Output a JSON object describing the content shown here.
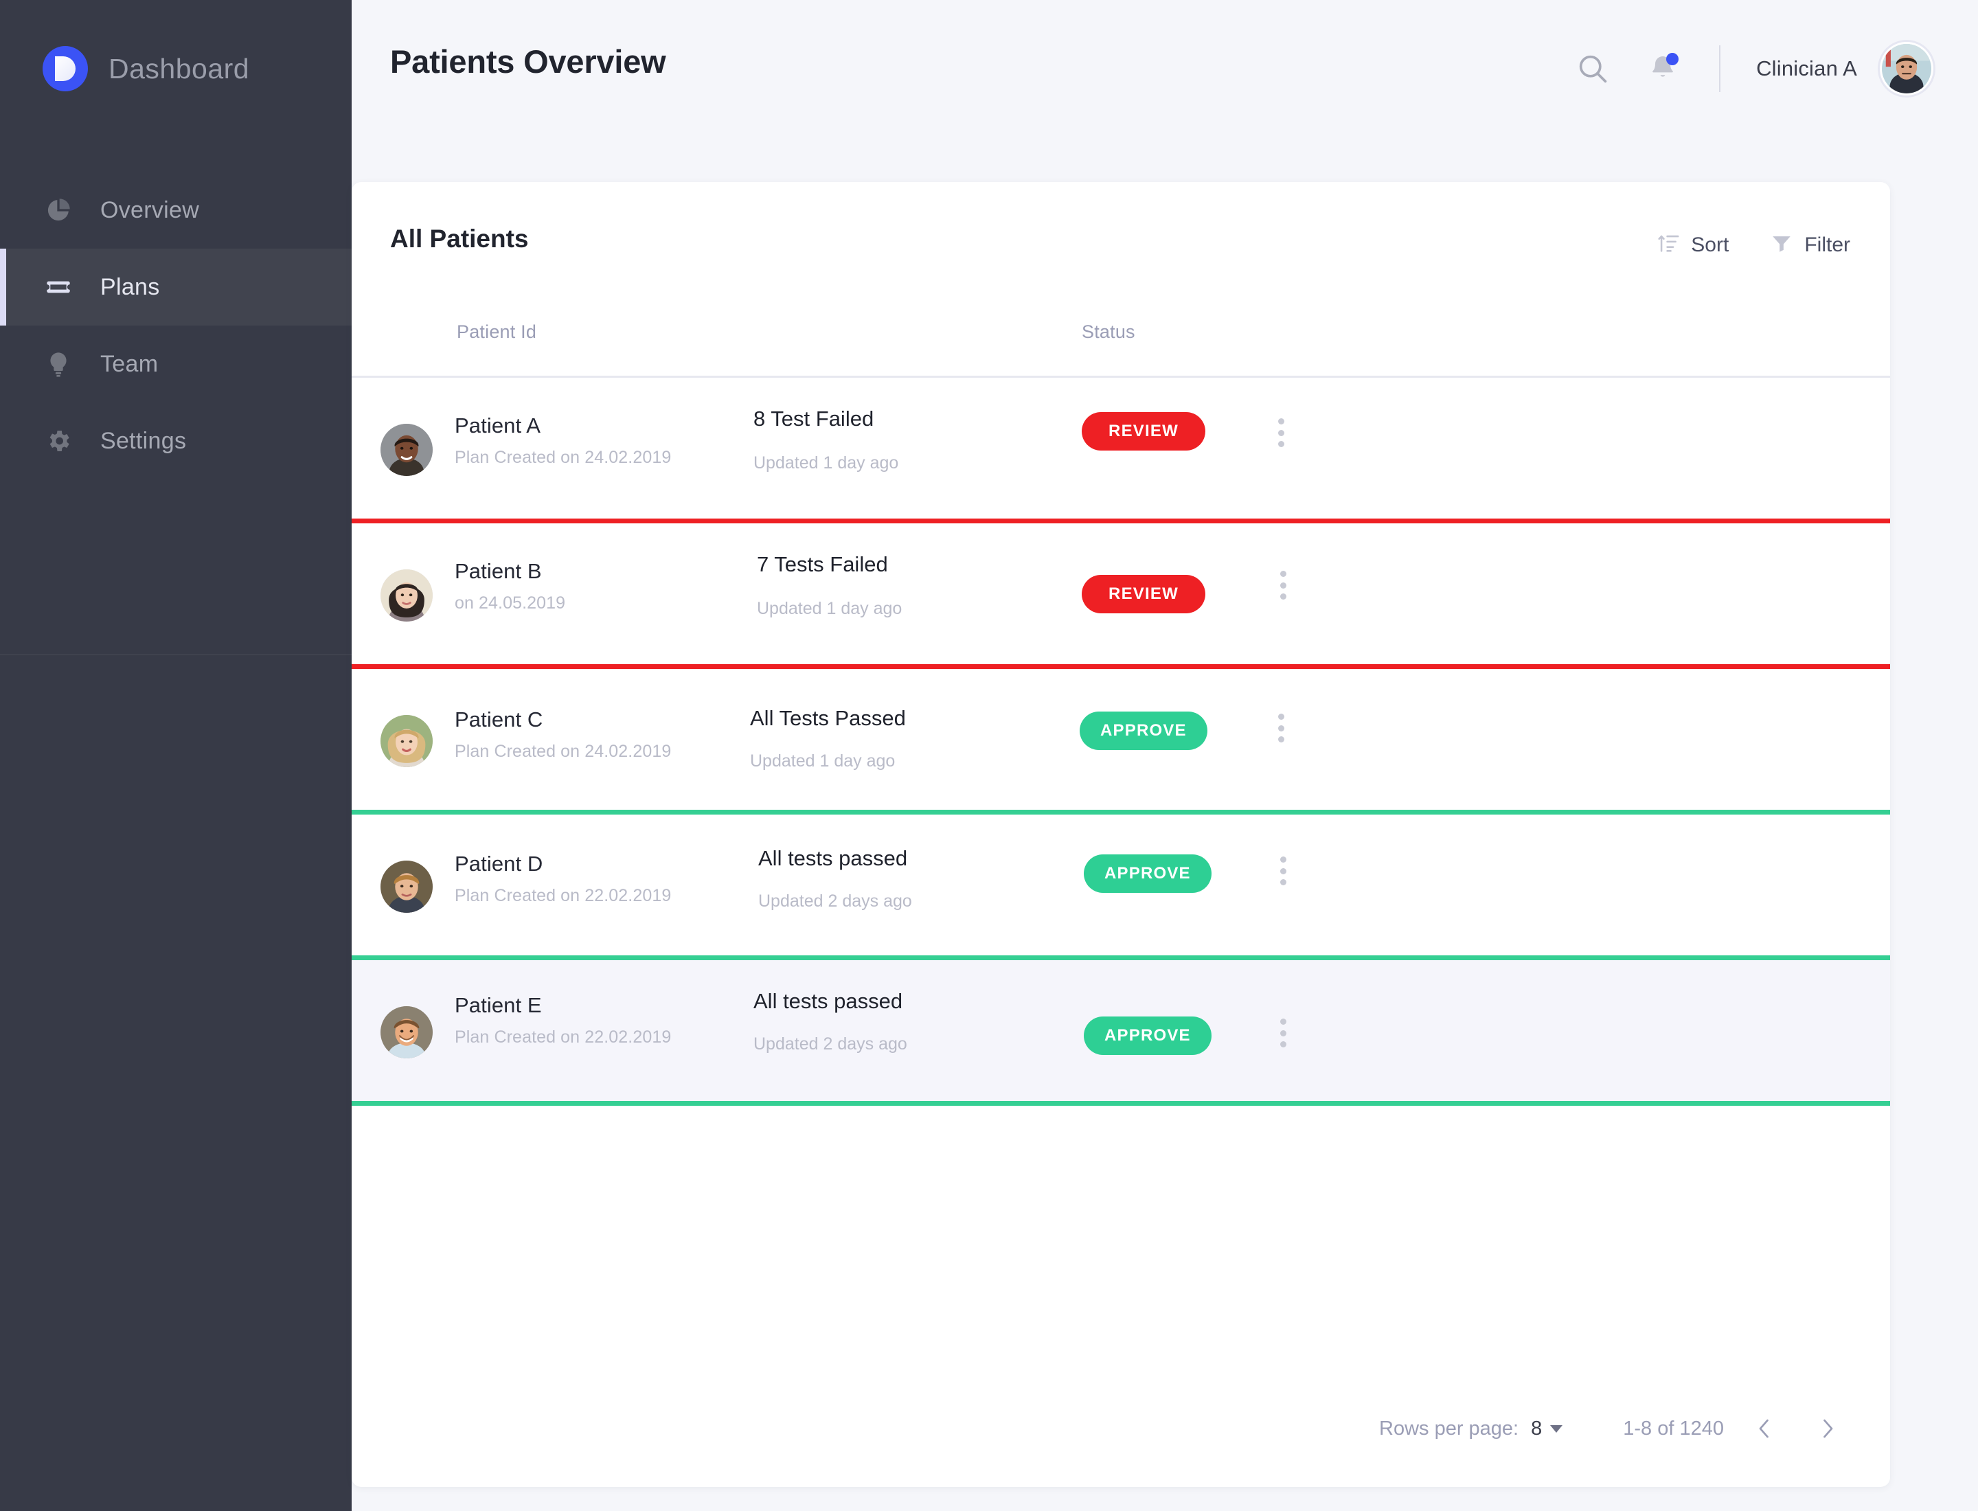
{
  "sidebar": {
    "brand": {
      "name": "Dashboard",
      "logo_icon": "logo-d-mark",
      "logo_color": "#3b53f5"
    },
    "items": [
      {
        "label": "Overview",
        "icon": "pie-chart-icon",
        "active": false
      },
      {
        "label": "Plans",
        "icon": "ticket-icon",
        "active": true
      },
      {
        "label": "Team",
        "icon": "bulb-icon",
        "active": false
      },
      {
        "label": "Settings",
        "icon": "gear-icon",
        "active": false
      }
    ]
  },
  "header": {
    "title": "Patients Overview",
    "search_icon": "search-icon",
    "notification_icon": "bell-icon",
    "notification_dot_color": "#3b53f5",
    "user_name": "Clinician A",
    "avatar_icon": "user-avatar"
  },
  "card": {
    "title": "All Patients",
    "tools": [
      {
        "label": "Sort",
        "icon": "sort-icon"
      },
      {
        "label": "Filter",
        "icon": "filter-icon"
      }
    ],
    "columns": {
      "patient": "Patient Id",
      "status": "Status"
    },
    "rows": [
      {
        "name": "Patient A",
        "sub": "Plan Created on 24.02.2019",
        "test": "8 Test Failed",
        "updated": "Updated 1 day ago",
        "badge": "REVIEW",
        "badge_kind": "review",
        "accent": "#ee2024",
        "selected": false
      },
      {
        "name": "Patient B",
        "sub": "on 24.05.2019",
        "test": "7 Tests Failed",
        "updated": "Updated 1 day ago",
        "badge": "REVIEW",
        "badge_kind": "review",
        "accent": "#ee2024",
        "selected": false
      },
      {
        "name": "Patient C",
        "sub": "Plan Created on 24.02.2019",
        "test": "All Tests Passed",
        "updated": "Updated 1 day ago",
        "badge": "APPROVE",
        "badge_kind": "approve",
        "accent": "#35cf93",
        "selected": false
      },
      {
        "name": "Patient D",
        "sub": "Plan Created on 22.02.2019",
        "test": "All tests passed",
        "updated": "Updated 2 days ago",
        "badge": "APPROVE",
        "badge_kind": "approve",
        "accent": "#35cf93",
        "selected": false
      },
      {
        "name": "Patient E",
        "sub": "Plan Created on 22.02.2019",
        "test": "All tests passed",
        "updated": "Updated 2 days ago",
        "badge": "APPROVE",
        "badge_kind": "approve",
        "accent": "#35cf93",
        "selected": true
      }
    ],
    "pagination": {
      "rows_per_page_label": "Rows per page:",
      "rows_per_page_value": "8",
      "range": "1-8 of 1240",
      "prev_icon": "chevron-left-icon",
      "next_icon": "chevron-right-icon"
    }
  },
  "colors": {
    "sidebar_bg": "#373a47",
    "page_bg": "#f5f6fa",
    "accent_blue": "#3b53f5",
    "danger": "#ee2024",
    "success": "#2ecf94",
    "selected_row": "#f5f5fb"
  }
}
